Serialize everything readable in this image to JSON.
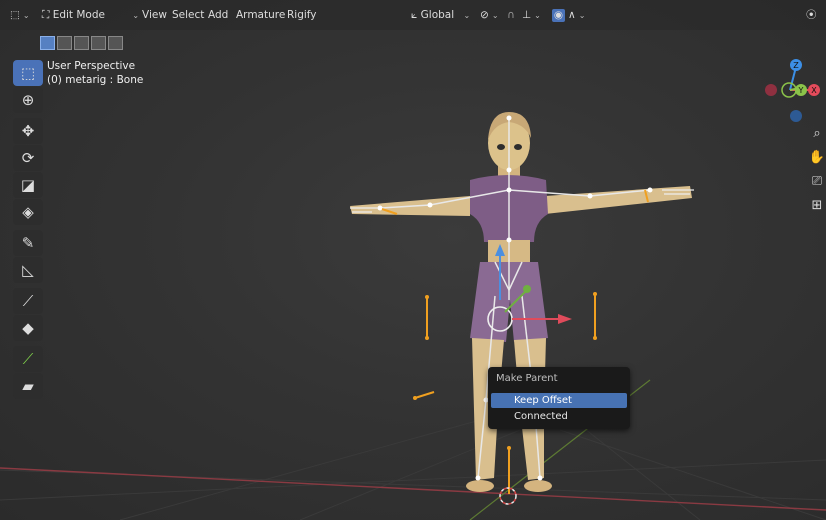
{
  "header": {
    "editor_icon": "view3d-icon",
    "mode_label": "Edit Mode",
    "menus": [
      "View",
      "Select",
      "Add",
      "Armature",
      "Rigify"
    ],
    "orientation_label": "Global"
  },
  "overlay": {
    "perspective": "User Perspective",
    "object_info": "(0) metarig : Bone"
  },
  "toolbar": {
    "tools": [
      "select-box-icon",
      "cursor-icon",
      "move-icon",
      "rotate-icon",
      "scale-icon",
      "transform-icon",
      "annotate-icon",
      "measure-icon",
      "roll-icon",
      "bone-size-icon",
      "extrude-icon",
      "shear-icon"
    ]
  },
  "gizmo": {
    "z_label": "Z",
    "y_label": "Y",
    "x_label": "X",
    "colors": {
      "x": "#e44b5b",
      "y": "#8bc34a",
      "z": "#3c8fe6"
    }
  },
  "nav_buttons": [
    "zoom-icon",
    "pan-icon",
    "camera-icon",
    "grid-icon"
  ],
  "popup": {
    "title": "Make Parent",
    "items": [
      "Keep Offset",
      "Connected"
    ],
    "highlighted": "Keep Offset"
  }
}
